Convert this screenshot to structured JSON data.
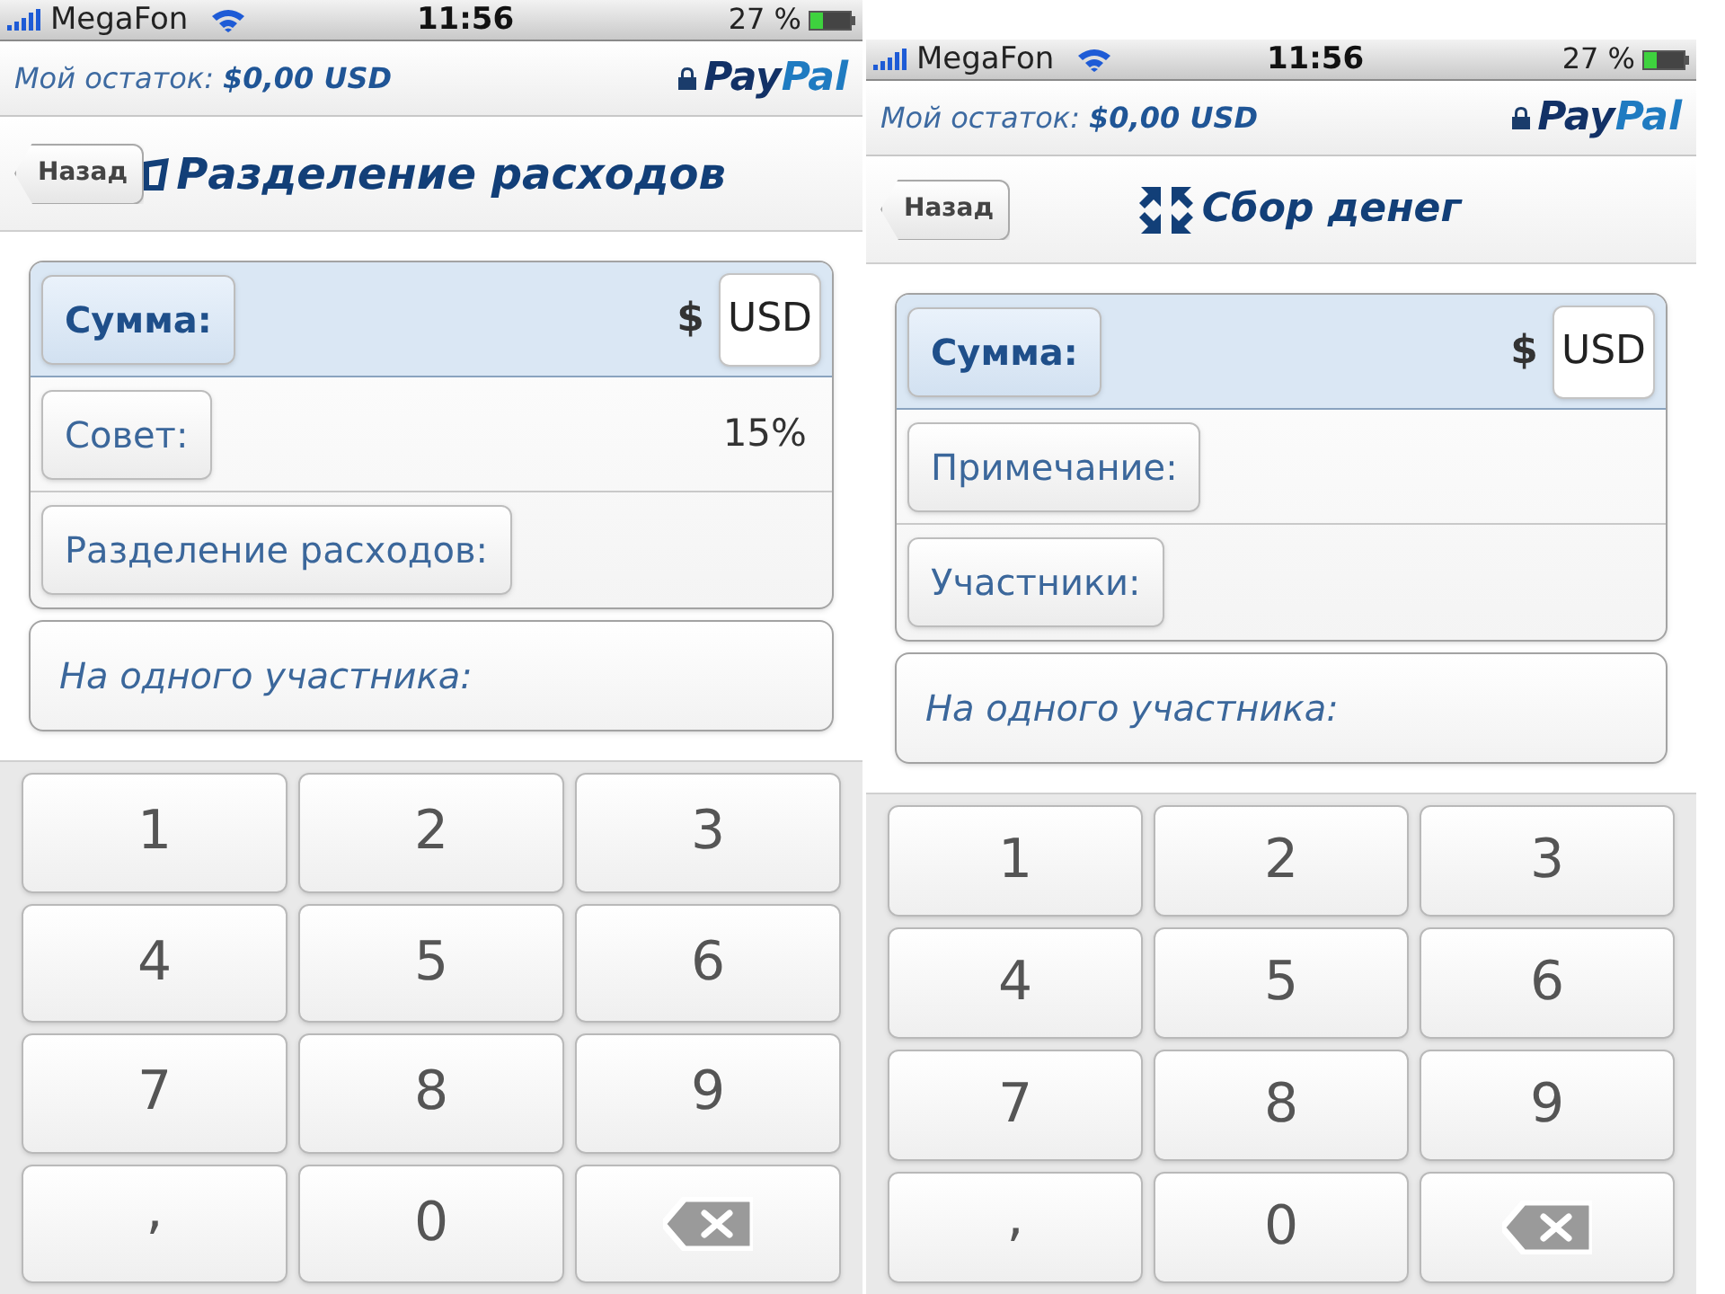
{
  "phones": [
    {
      "status_bar": {
        "carrier": "MegaFon",
        "time": "11:56",
        "battery": "27 %"
      },
      "balance": "Мой остаток: **$0,00 USD**",
      "brand": {
        "first": "Pay",
        "second": "Pal"
      },
      "nav": {
        "back": "Назад",
        "title": "Разделение расходов"
      },
      "fields": [
        {
          "kind": "amount",
          "label": "Сумма:",
          "symbol": "$",
          "currency": "USD"
        },
        {
          "kind": "button",
          "label": "Совет:",
          "value": "15%"
        },
        {
          "kind": "button",
          "label": "Разделение расходов:"
        }
      ],
      "result": "На одного участника:",
      "keys": [
        {
          "kind": "digit",
          "label": "1"
        },
        {
          "kind": "digit",
          "label": "2"
        },
        {
          "kind": "digit",
          "label": "3"
        },
        {
          "kind": "digit",
          "label": "4"
        },
        {
          "kind": "digit",
          "label": "5"
        },
        {
          "kind": "digit",
          "label": "6"
        },
        {
          "kind": "digit",
          "label": "7"
        },
        {
          "kind": "digit",
          "label": "8"
        },
        {
          "kind": "digit",
          "label": "9"
        },
        {
          "kind": "symbol",
          "label": ","
        },
        {
          "kind": "digit",
          "label": "0"
        },
        {
          "kind": "backspace"
        }
      ]
    },
    {
      "status_bar": {
        "carrier": "MegaFon",
        "time": "11:56",
        "battery": "27 %"
      },
      "balance": "Мой остаток: **$0,00 USD**",
      "brand": {
        "first": "Pay",
        "second": "Pal"
      },
      "nav": {
        "back": "Назад",
        "title": "Сбор денег"
      },
      "fields": [
        {
          "kind": "amount",
          "label": "Сумма:",
          "symbol": "$",
          "currency": "USD"
        },
        {
          "kind": "button",
          "label": "Примечание:"
        },
        {
          "kind": "button",
          "label": "Участники:"
        }
      ],
      "result": "На одного участника:",
      "keys": [
        {
          "kind": "digit",
          "label": "1"
        },
        {
          "kind": "digit",
          "label": "2"
        },
        {
          "kind": "digit",
          "label": "3"
        },
        {
          "kind": "digit",
          "label": "4"
        },
        {
          "kind": "digit",
          "label": "5"
        },
        {
          "kind": "digit",
          "label": "6"
        },
        {
          "kind": "digit",
          "label": "7"
        },
        {
          "kind": "digit",
          "label": "8"
        },
        {
          "kind": "digit",
          "label": "9"
        },
        {
          "kind": "symbol",
          "label": ","
        },
        {
          "kind": "digit",
          "label": "0"
        },
        {
          "kind": "backspace"
        }
      ]
    }
  ]
}
